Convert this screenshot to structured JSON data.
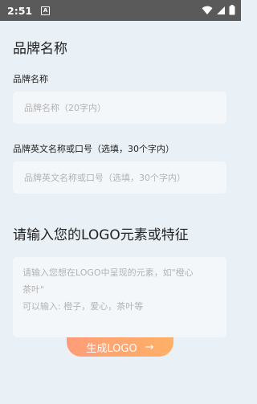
{
  "status_bar": {
    "time": "2:51",
    "notification": "A"
  },
  "form": {
    "brand_name_heading": "品牌名称",
    "brand_name_label": "品牌名称",
    "brand_name_placeholder": "品牌名称（20字内）",
    "english_label": "品牌英文名称或口号（选填，30个字内）",
    "english_placeholder": "品牌英文名称或口号（选填，30个字内）",
    "logo_heading": "请输入您的LOGO元素或特征",
    "logo_placeholder_line1": "请输入您想在LOGO中呈现的元素，如\"橙心",
    "logo_placeholder_line2": "茶叶\"",
    "logo_placeholder_line3": "可以输入: 橙子，爱心，茶叶等",
    "generate_button": "生成LOGO",
    "generate_arrow": "→"
  }
}
